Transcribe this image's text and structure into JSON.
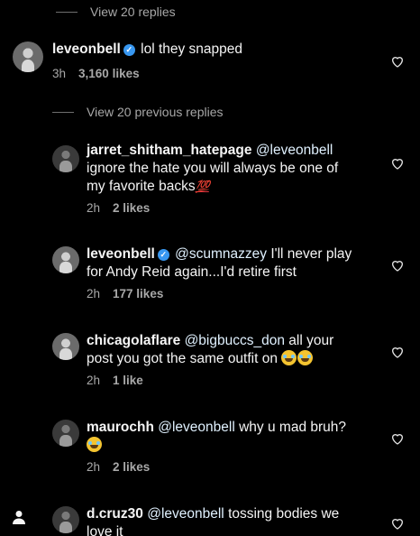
{
  "top_view_replies": "View 20 replies",
  "main_comment": {
    "username": "leveonbell",
    "text": "lol they snapped",
    "time": "3h",
    "likes": "3,160 likes"
  },
  "previous_replies": "View 20 previous replies",
  "replies": [
    {
      "username": "jarret_shitham_hatepage",
      "mention": "@leveonbell",
      "line1": "ignore the hate you will always be one of",
      "line2": "my favorite backs",
      "emoji": "💯",
      "time": "2h",
      "likes": "2 likes"
    },
    {
      "username": "leveonbell",
      "mention": "@scumnazzey",
      "line1_tail": "I'll never play",
      "line2": "for Andy Reid again...I'd retire first",
      "time": "2h",
      "likes": "177 likes"
    },
    {
      "username": "chicagolaflare",
      "mention": "@bigbuccs_don",
      "line1_tail": "all your",
      "line2": "post you got the same outfit on",
      "time": "2h",
      "likes": "1 like"
    },
    {
      "username": "maurochh",
      "mention": "@leveonbell",
      "line1_tail": "why u mad bruh?",
      "time": "2h",
      "likes": "2 likes"
    },
    {
      "username": "d.cruz30",
      "mention": "@leveonbell",
      "line1_tail": "tossing bodies we",
      "line2": "love it"
    }
  ],
  "icons": {
    "like": "heart-outline-icon",
    "verified": "verified-badge-icon",
    "profile": "profile-icon",
    "emoji_laugh": "face-with-tears-of-joy-icon",
    "emoji_crying": "loudly-crying-face-icon"
  },
  "colors": {
    "background": "#000000",
    "text": "#f5f5f5",
    "secondary": "#a8a8a8",
    "verified": "#3897f0",
    "hundred": "#e0333c"
  }
}
